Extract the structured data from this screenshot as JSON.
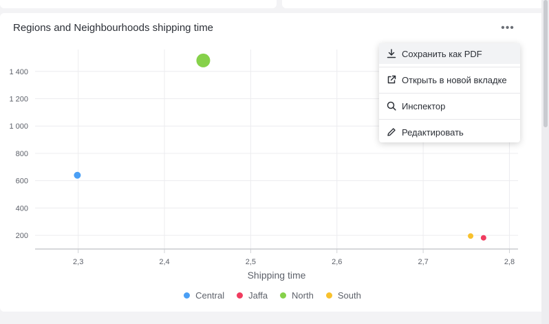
{
  "card": {
    "title": "Regions and Neighbourhoods shipping time",
    "more_label": "•••"
  },
  "menu": {
    "items": [
      {
        "label": "Сохранить как PDF",
        "icon": "download-icon"
      },
      {
        "label": "Открыть в новой вкладке",
        "icon": "external-link-icon"
      },
      {
        "label": "Инспектор",
        "icon": "search-icon"
      },
      {
        "label": "Редактировать",
        "icon": "pencil-icon"
      }
    ]
  },
  "chart_data": {
    "type": "scatter",
    "title": "",
    "xlabel": "Shipping time",
    "ylabel": "",
    "xlim": [
      2.25,
      2.81
    ],
    "ylim": [
      100,
      1560
    ],
    "x_ticks": [
      2.3,
      2.4,
      2.5,
      2.6,
      2.7,
      2.8
    ],
    "x_tick_labels": [
      "2,3",
      "2,4",
      "2,5",
      "2,6",
      "2,7",
      "2,8"
    ],
    "y_ticks": [
      200,
      400,
      600,
      800,
      1000,
      1200,
      1400
    ],
    "y_tick_labels": [
      "200",
      "400",
      "600",
      "800",
      "1 000",
      "1 200",
      "1 400"
    ],
    "grid": true,
    "legend_position": "bottom",
    "series": [
      {
        "name": "Central",
        "color": "#4a9ff5",
        "points": [
          {
            "x": 2.299,
            "y": 640,
            "size": 4
          }
        ]
      },
      {
        "name": "Jaffa",
        "color": "#f03c5f",
        "points": [
          {
            "x": 2.77,
            "y": 182,
            "size": 3
          }
        ]
      },
      {
        "name": "North",
        "color": "#86d14a",
        "points": [
          {
            "x": 2.445,
            "y": 1480,
            "size": 9
          }
        ]
      },
      {
        "name": "South",
        "color": "#f8c12d",
        "points": [
          {
            "x": 2.755,
            "y": 195,
            "size": 3
          }
        ]
      }
    ]
  }
}
